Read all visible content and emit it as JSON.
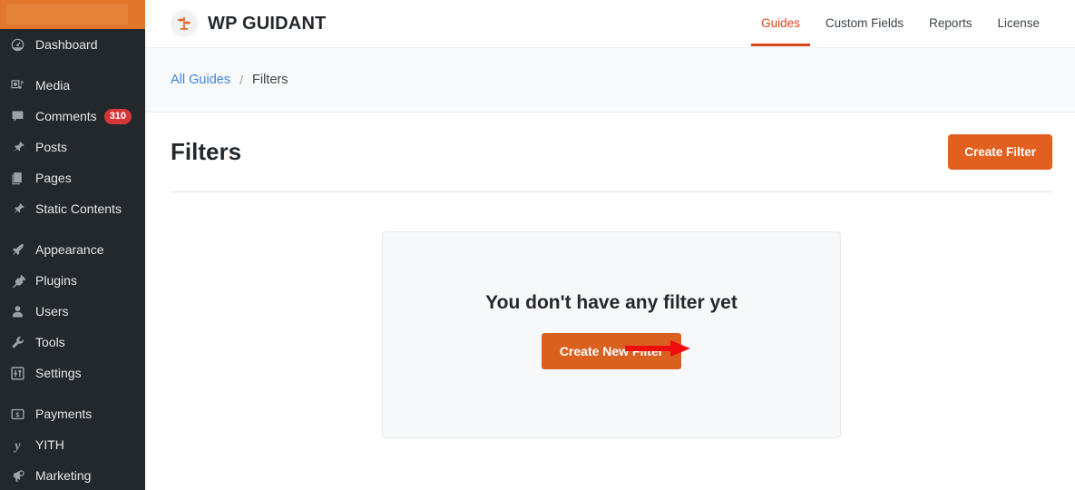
{
  "admin_sidebar": {
    "items": [
      {
        "label": "Dashboard",
        "icon": "dashboard-gauge-icon",
        "badge": null,
        "separator_before": false
      },
      {
        "label": "Media",
        "icon": "media-photo-icon",
        "badge": null,
        "separator_before": true
      },
      {
        "label": "Comments",
        "icon": "comment-bubble-icon",
        "badge": "310",
        "separator_before": false
      },
      {
        "label": "Posts",
        "icon": "pushpin-icon",
        "badge": null,
        "separator_before": false
      },
      {
        "label": "Pages",
        "icon": "pages-icon",
        "badge": null,
        "separator_before": false
      },
      {
        "label": "Static Contents",
        "icon": "pushpin-icon",
        "badge": null,
        "separator_before": false
      },
      {
        "label": "Appearance",
        "icon": "paintbrush-icon",
        "badge": null,
        "separator_before": true
      },
      {
        "label": "Plugins",
        "icon": "plug-icon",
        "badge": null,
        "separator_before": false
      },
      {
        "label": "Users",
        "icon": "user-icon",
        "badge": null,
        "separator_before": false
      },
      {
        "label": "Tools",
        "icon": "wrench-icon",
        "badge": null,
        "separator_before": false
      },
      {
        "label": "Settings",
        "icon": "sliders-icon",
        "badge": null,
        "separator_before": false
      },
      {
        "label": "Payments",
        "icon": "dollar-box-icon",
        "badge": null,
        "separator_before": true
      },
      {
        "label": "YITH",
        "icon": "yith-y-icon",
        "badge": null,
        "separator_before": false
      },
      {
        "label": "Marketing",
        "icon": "megaphone-icon",
        "badge": null,
        "separator_before": false
      }
    ]
  },
  "header": {
    "logo_icon": "signpost-icon",
    "brand": "WP GUIDANT",
    "nav": [
      {
        "label": "Guides",
        "active": true
      },
      {
        "label": "Custom Fields",
        "active": false
      },
      {
        "label": "Reports",
        "active": false
      },
      {
        "label": "License",
        "active": false
      }
    ]
  },
  "breadcrumb": {
    "root": "All Guides",
    "separator": "/",
    "current": "Filters"
  },
  "page": {
    "title": "Filters",
    "create_button": "Create Filter"
  },
  "empty_state": {
    "message": "You don't have any filter yet",
    "button": "Create New Filter"
  },
  "annotation": {
    "arrow_icon": "red-arrow-right-icon",
    "arrow_color": "#f10d0d",
    "points_to": "Create New Filter"
  },
  "colors": {
    "accent_orange": "#e2601f",
    "button_orange": "#d9601f",
    "active_tab": "#d9451a",
    "sidebar_bg": "#23282d",
    "admin_bar": "#e2762c",
    "badge_red": "#d63638",
    "link_blue": "#3d85e0",
    "card_bg": "#f7f8fa",
    "crumb_bar_bg": "#f8f9fb"
  }
}
